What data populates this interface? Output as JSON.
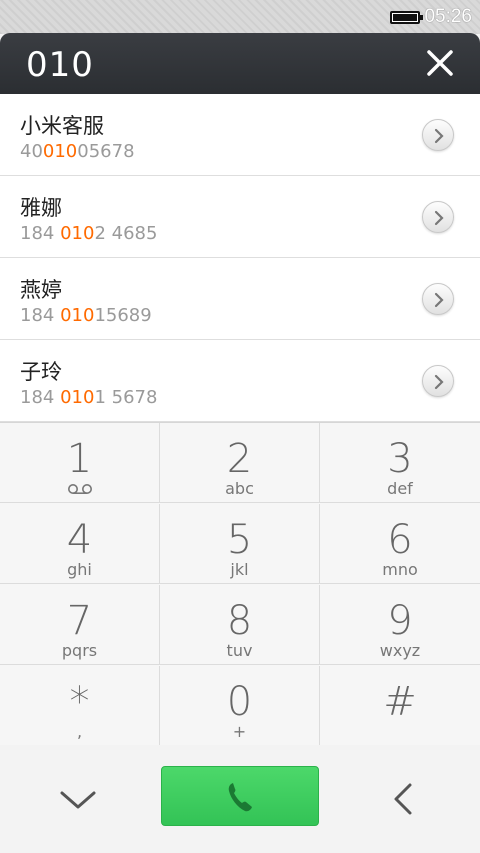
{
  "status_bar": {
    "time": "05:26"
  },
  "dialer": {
    "input_number": "010"
  },
  "results": [
    {
      "name": "小米客服",
      "phone_prefix": "40",
      "phone_match": "010",
      "phone_suffix": "05678"
    },
    {
      "name": "雅娜",
      "phone_prefix": "184 ",
      "phone_match": "010",
      "phone_suffix": "2 4685"
    },
    {
      "name": "燕婷",
      "phone_prefix": "184 ",
      "phone_match": "010",
      "phone_suffix": "15689"
    },
    {
      "name": "子玲",
      "phone_prefix": "184 ",
      "phone_match": "010",
      "phone_suffix": "1 5678"
    }
  ],
  "keypad": [
    {
      "digit": "1",
      "letters": ""
    },
    {
      "digit": "2",
      "letters": "abc"
    },
    {
      "digit": "3",
      "letters": "def"
    },
    {
      "digit": "4",
      "letters": "ghi"
    },
    {
      "digit": "5",
      "letters": "jkl"
    },
    {
      "digit": "6",
      "letters": "mno"
    },
    {
      "digit": "7",
      "letters": "pqrs"
    },
    {
      "digit": "8",
      "letters": "tuv"
    },
    {
      "digit": "9",
      "letters": "wxyz"
    },
    {
      "digit": "*",
      "letters": ","
    },
    {
      "digit": "0",
      "letters": "+"
    },
    {
      "digit": "#",
      "letters": ""
    }
  ],
  "icons": {
    "clear": "close-icon",
    "voicemail": "voicemail-icon",
    "collapse": "chevron-down-icon",
    "call": "phone-icon",
    "backspace": "chevron-left-icon",
    "detail": "chevron-right-icon"
  },
  "colors": {
    "highlight": "#ff6a00",
    "call_button": "#3fcf5f",
    "header": "#33363a"
  }
}
